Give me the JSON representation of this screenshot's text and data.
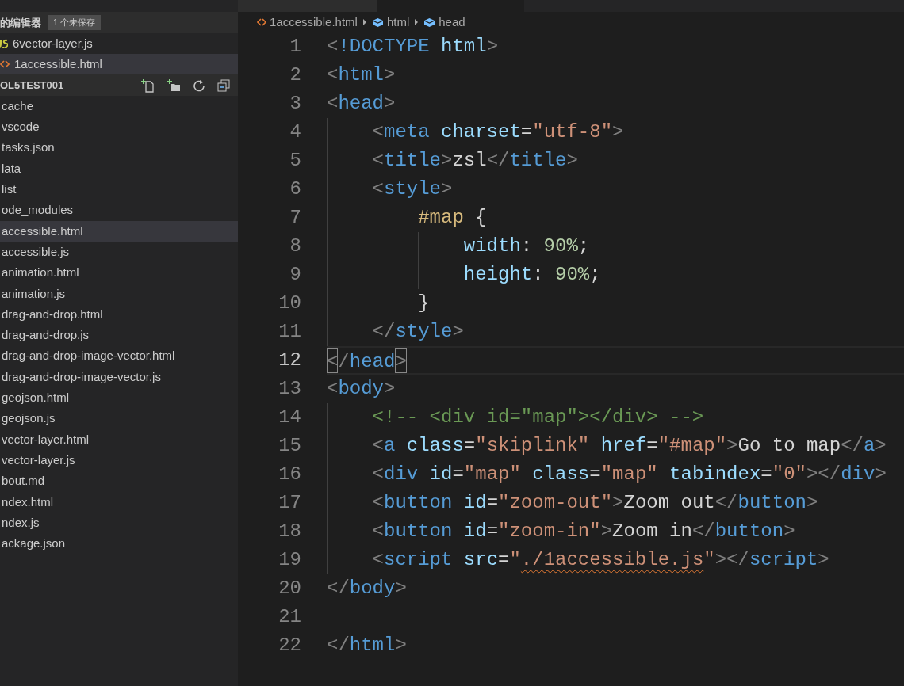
{
  "editor_tabs": [
    {
      "selected": false
    },
    {
      "selected": true
    }
  ],
  "sidebar": {
    "open_editors": {
      "title": "的编辑器",
      "badge": "1 个未保存",
      "items": [
        {
          "name": "6vector-layer.js",
          "kind": "js",
          "selected": false
        },
        {
          "name": "1accessible.html",
          "kind": "html",
          "selected": true
        }
      ]
    },
    "folder": {
      "title": "OL5TEST001",
      "items": [
        {
          "name": "cache",
          "selected": false
        },
        {
          "name": "vscode",
          "selected": false
        },
        {
          "name": "tasks.json",
          "selected": false
        },
        {
          "name": "lata",
          "selected": false
        },
        {
          "name": "list",
          "selected": false
        },
        {
          "name": "ode_modules",
          "selected": false
        },
        {
          "name": "accessible.html",
          "selected": true
        },
        {
          "name": "accessible.js",
          "selected": false
        },
        {
          "name": "animation.html",
          "selected": false
        },
        {
          "name": "animation.js",
          "selected": false
        },
        {
          "name": "drag-and-drop.html",
          "selected": false
        },
        {
          "name": "drag-and-drop.js",
          "selected": false
        },
        {
          "name": "drag-and-drop-image-vector.html",
          "selected": false
        },
        {
          "name": "drag-and-drop-image-vector.js",
          "selected": false
        },
        {
          "name": "geojson.html",
          "selected": false
        },
        {
          "name": "geojson.js",
          "selected": false
        },
        {
          "name": "vector-layer.html",
          "selected": false
        },
        {
          "name": "vector-layer.js",
          "selected": false
        },
        {
          "name": "bout.md",
          "selected": false
        },
        {
          "name": "ndex.html",
          "selected": false
        },
        {
          "name": "ndex.js",
          "selected": false
        },
        {
          "name": "ackage.json",
          "selected": false
        }
      ]
    }
  },
  "breadcrumbs": [
    {
      "label": "1accessible.html",
      "kind": "file"
    },
    {
      "label": "html",
      "kind": "element"
    },
    {
      "label": "head",
      "kind": "element"
    }
  ],
  "code": [
    {
      "number": "1",
      "current": false,
      "tokens": [
        {
          "t": "<",
          "kind": "punct"
        },
        {
          "t": "!DOCTYPE",
          "kind": "tag"
        },
        {
          "t": " html",
          "kind": "attr"
        },
        {
          "t": ">",
          "kind": "punct"
        }
      ]
    },
    {
      "number": "2",
      "current": false,
      "tokens": [
        {
          "t": "<",
          "kind": "punct"
        },
        {
          "t": "html",
          "kind": "tag"
        },
        {
          "t": ">",
          "kind": "punct"
        }
      ]
    },
    {
      "number": "3",
      "current": false,
      "tokens": [
        {
          "t": "<",
          "kind": "punct"
        },
        {
          "t": "head",
          "kind": "tag"
        },
        {
          "t": ">",
          "kind": "punct"
        }
      ],
      "children": [
        {
          "number": "4",
          "current": false,
          "tokens": [
            {
              "t": "<",
              "kind": "punct"
            },
            {
              "t": "meta",
              "kind": "tag"
            },
            {
              "t": " charset",
              "kind": "attr"
            },
            {
              "t": "=",
              "kind": "text"
            },
            {
              "t": "\"utf-8\"",
              "kind": "str"
            },
            {
              "t": ">",
              "kind": "punct"
            }
          ]
        },
        {
          "number": "5",
          "current": false,
          "tokens": [
            {
              "t": "<",
              "kind": "punct"
            },
            {
              "t": "title",
              "kind": "tag"
            },
            {
              "t": ">",
              "kind": "punct"
            },
            {
              "t": "zsl",
              "kind": "text"
            },
            {
              "t": "</",
              "kind": "punct"
            },
            {
              "t": "title",
              "kind": "tag"
            },
            {
              "t": ">",
              "kind": "punct"
            }
          ]
        },
        {
          "number": "6",
          "current": false,
          "tokens": [
            {
              "t": "<",
              "kind": "punct"
            },
            {
              "t": "style",
              "kind": "tag"
            },
            {
              "t": ">",
              "kind": "punct"
            }
          ],
          "children": [
            {
              "number": "7",
              "current": false,
              "tokens": [
                {
                  "t": "#map",
                  "kind": "selector"
                },
                {
                  "t": " {",
                  "kind": "text"
                }
              ],
              "children": [
                {
                  "number": "8",
                  "current": false,
                  "tokens": [
                    {
                      "t": "width",
                      "kind": "attr"
                    },
                    {
                      "t": ": ",
                      "kind": "text"
                    },
                    {
                      "t": "90%",
                      "kind": "num"
                    },
                    {
                      "t": ";",
                      "kind": "text"
                    }
                  ]
                },
                {
                  "number": "9",
                  "current": false,
                  "tokens": [
                    {
                      "t": "height",
                      "kind": "attr"
                    },
                    {
                      "t": ": ",
                      "kind": "text"
                    },
                    {
                      "t": "90%",
                      "kind": "num"
                    },
                    {
                      "t": ";",
                      "kind": "text"
                    }
                  ]
                }
              ]
            },
            {
              "number": "10",
              "current": false,
              "tokens": [
                {
                  "t": "}",
                  "kind": "text"
                }
              ]
            }
          ]
        },
        {
          "number": "11",
          "current": false,
          "tokens": [
            {
              "t": "</",
              "kind": "punct"
            },
            {
              "t": "style",
              "kind": "tag"
            },
            {
              "t": ">",
              "kind": "punct"
            }
          ]
        }
      ]
    },
    {
      "number": "12",
      "current": true,
      "tokens": [
        {
          "t": "<",
          "kind": "punct",
          "matched": true
        },
        {
          "t": "/",
          "kind": "punct"
        },
        {
          "t": "head",
          "kind": "tag"
        },
        {
          "t": ">",
          "kind": "punct",
          "matched": true
        }
      ]
    },
    {
      "number": "13",
      "current": false,
      "tokens": [
        {
          "t": "<",
          "kind": "punct"
        },
        {
          "t": "body",
          "kind": "tag"
        },
        {
          "t": ">",
          "kind": "punct"
        }
      ],
      "children": [
        {
          "number": "14",
          "current": false,
          "tokens": [
            {
              "t": "<!-- <div id=\"map\"></div> -->",
              "kind": "comment"
            }
          ]
        },
        {
          "number": "15",
          "current": false,
          "tokens": [
            {
              "t": "<",
              "kind": "punct"
            },
            {
              "t": "a",
              "kind": "tag"
            },
            {
              "t": " class",
              "kind": "attr"
            },
            {
              "t": "=",
              "kind": "text"
            },
            {
              "t": "\"skiplink\"",
              "kind": "str"
            },
            {
              "t": " href",
              "kind": "attr"
            },
            {
              "t": "=",
              "kind": "text"
            },
            {
              "t": "\"#map\"",
              "kind": "str"
            },
            {
              "t": ">",
              "kind": "punct"
            },
            {
              "t": "Go to map",
              "kind": "text"
            },
            {
              "t": "</",
              "kind": "punct"
            },
            {
              "t": "a",
              "kind": "tag"
            },
            {
              "t": ">",
              "kind": "punct"
            }
          ]
        },
        {
          "number": "16",
          "current": false,
          "tokens": [
            {
              "t": "<",
              "kind": "punct"
            },
            {
              "t": "div",
              "kind": "tag"
            },
            {
              "t": " id",
              "kind": "attr"
            },
            {
              "t": "=",
              "kind": "text"
            },
            {
              "t": "\"map\"",
              "kind": "str"
            },
            {
              "t": " class",
              "kind": "attr"
            },
            {
              "t": "=",
              "kind": "text"
            },
            {
              "t": "\"map\"",
              "kind": "str"
            },
            {
              "t": " tabindex",
              "kind": "attr"
            },
            {
              "t": "=",
              "kind": "text"
            },
            {
              "t": "\"0\"",
              "kind": "str"
            },
            {
              "t": "></",
              "kind": "punct"
            },
            {
              "t": "div",
              "kind": "tag"
            },
            {
              "t": ">",
              "kind": "punct"
            }
          ]
        },
        {
          "number": "17",
          "current": false,
          "tokens": [
            {
              "t": "<",
              "kind": "punct"
            },
            {
              "t": "button",
              "kind": "tag"
            },
            {
              "t": " id",
              "kind": "attr"
            },
            {
              "t": "=",
              "kind": "text"
            },
            {
              "t": "\"zoom-out\"",
              "kind": "str"
            },
            {
              "t": ">",
              "kind": "punct"
            },
            {
              "t": "Zoom out",
              "kind": "text"
            },
            {
              "t": "</",
              "kind": "punct"
            },
            {
              "t": "button",
              "kind": "tag"
            },
            {
              "t": ">",
              "kind": "punct"
            }
          ]
        },
        {
          "number": "18",
          "current": false,
          "tokens": [
            {
              "t": "<",
              "kind": "punct"
            },
            {
              "t": "button",
              "kind": "tag"
            },
            {
              "t": " id",
              "kind": "attr"
            },
            {
              "t": "=",
              "kind": "text"
            },
            {
              "t": "\"zoom-in\"",
              "kind": "str"
            },
            {
              "t": ">",
              "kind": "punct"
            },
            {
              "t": "Zoom in",
              "kind": "text"
            },
            {
              "t": "</",
              "kind": "punct"
            },
            {
              "t": "button",
              "kind": "tag"
            },
            {
              "t": ">",
              "kind": "punct"
            }
          ]
        },
        {
          "number": "19",
          "current": false,
          "tokens": [
            {
              "t": "<",
              "kind": "punct"
            },
            {
              "t": "script",
              "kind": "tag"
            },
            {
              "t": " src",
              "kind": "attr"
            },
            {
              "t": "=",
              "kind": "text"
            },
            {
              "t": "\"",
              "kind": "str"
            },
            {
              "t": "./1accessible.js",
              "kind": "str",
              "squiggle": true
            },
            {
              "t": "\"",
              "kind": "str"
            },
            {
              "t": "></",
              "kind": "punct"
            },
            {
              "t": "script",
              "kind": "tag"
            },
            {
              "t": ">",
              "kind": "punct"
            }
          ]
        }
      ]
    },
    {
      "number": "20",
      "current": false,
      "tokens": [
        {
          "t": "</",
          "kind": "punct"
        },
        {
          "t": "body",
          "kind": "tag"
        },
        {
          "t": ">",
          "kind": "punct"
        }
      ]
    },
    {
      "number": "21",
      "current": false
    },
    {
      "number": "22",
      "current": false,
      "tokens": [
        {
          "t": "</",
          "kind": "punct"
        },
        {
          "t": "html",
          "kind": "tag"
        },
        {
          "t": ">",
          "kind": "punct"
        }
      ]
    }
  ]
}
